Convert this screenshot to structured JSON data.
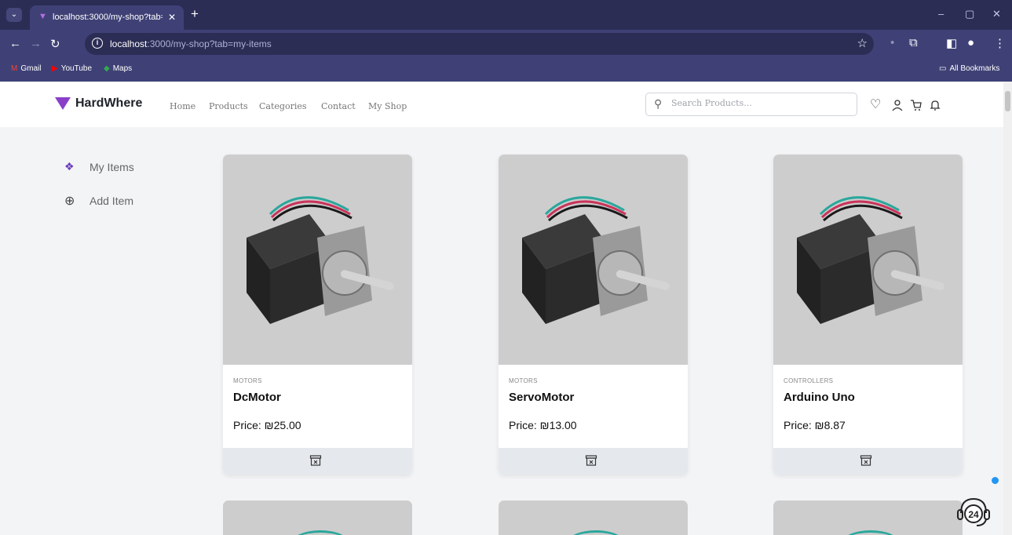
{
  "browser": {
    "tab_title": "localhost:3000/my-shop?tab=my-items",
    "url_host": "localhost",
    "url_rest": ":3000/my-shop?tab=my-items",
    "bookmarks": [
      "Gmail",
      "YouTube",
      "Maps"
    ],
    "all_bookmarks": "All Bookmarks"
  },
  "header": {
    "brand": "HardWhere",
    "nav": [
      "Home",
      "Products",
      "Categories",
      "Contact",
      "My Shop"
    ],
    "search_placeholder": "Search Products..."
  },
  "sidebar": {
    "items": [
      {
        "label": "My Items",
        "icon": "dropbox-icon"
      },
      {
        "label": "Add Item",
        "icon": "plus-circle-icon"
      }
    ]
  },
  "products": [
    {
      "category": "MOTORS",
      "name": "DcMotor",
      "price": "Price: ₪25.00"
    },
    {
      "category": "MOTORS",
      "name": "ServoMotor",
      "price": "Price: ₪13.00"
    },
    {
      "category": "CONTROLLERS",
      "name": "Arduino Uno",
      "price": "Price: ₪8.87"
    }
  ],
  "support_badge": "24",
  "colors": {
    "brand": "#8b3fc9",
    "chrome_dark": "#2b2d55",
    "chrome": "#3f4176",
    "card_footer": "#e5e9ed",
    "image_bg": "#cdcdcd"
  }
}
